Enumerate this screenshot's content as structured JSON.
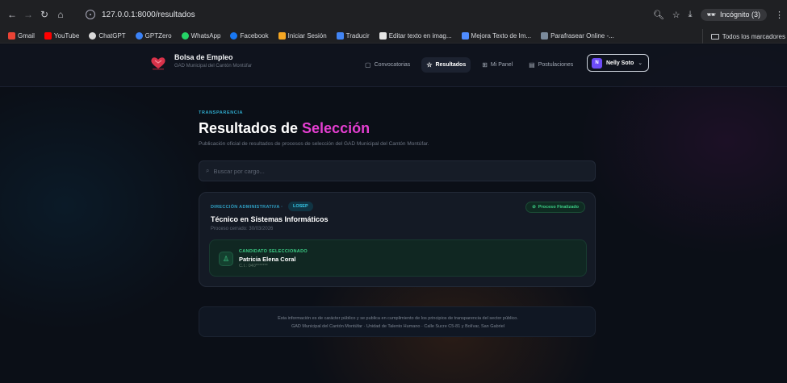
{
  "browser": {
    "url": "127.0.0.1:8000/resultados",
    "incognito_label": "Incógnito (3)",
    "bookmarks": [
      {
        "label": "Gmail",
        "color": "#ea4335"
      },
      {
        "label": "YouTube",
        "color": "#ff0000"
      },
      {
        "label": "ChatGPT",
        "color": "#d9d9d9"
      },
      {
        "label": "GPTZero",
        "color": "#3b82f6"
      },
      {
        "label": "WhatsApp",
        "color": "#25d366"
      },
      {
        "label": "Facebook",
        "color": "#1877f2"
      },
      {
        "label": "Iniciar Sesión",
        "color": "#f5a623"
      },
      {
        "label": "Traducir",
        "color": "#4285f4"
      },
      {
        "label": "Editar texto en imag...",
        "color": "#e6e6e6"
      },
      {
        "label": "Mejora Texto de Im...",
        "color": "#4f8cff"
      },
      {
        "label": "Parafrasear Online -...",
        "color": "#7b8a9b"
      }
    ],
    "bookmarks_folder": "Todos los marcadores"
  },
  "header": {
    "brand_title": "Bolsa de Empleo",
    "brand_subtitle": "GAD Municipal del Cantón Montúfar",
    "nav": [
      {
        "label": "Convocatorias",
        "icon": "document-icon"
      },
      {
        "label": "Resultados",
        "icon": "star-icon",
        "active": true
      },
      {
        "label": "Mi Panel",
        "icon": "grid-icon"
      },
      {
        "label": "Postulaciones",
        "icon": "file-icon"
      }
    ],
    "user": {
      "initial": "N",
      "name": "Nelly Soto"
    }
  },
  "hero": {
    "eyebrow": "TRANSPARENCIA",
    "title_main": "Resultados de ",
    "title_accent": "Selección",
    "description": "Publicación oficial de resultados de procesos de selección del GAD Municipal del Cantón Montúfar."
  },
  "search": {
    "placeholder": "Buscar por cargo..."
  },
  "result": {
    "department": "DIRECCIÓN ADMINISTRATIVA",
    "separator": "·",
    "tag": "LOSEP",
    "status": "Proceso Finalizado",
    "title": "Técnico en Sistemas Informáticos",
    "closed": "Proceso cerrado: 30/03/2026",
    "candidate_label": "CANDIDATO SELECCIONADO",
    "candidate_name": "Patricia Elena Coral",
    "candidate_ci": "C.I.: 040*******"
  },
  "footer": {
    "line1": "Esta información es de carácter público y se publica en cumplimiento de los principios de transparencia del sector público.",
    "line2": "GAD Municipal del Cantón Montúfar · Unidad de Talento Humano · Calle Sucre C5-81 y Bolívar, San Gabriel"
  },
  "colors": {
    "accent": "#e63fd2",
    "teal": "#2fa8c9",
    "success": "#3ccf86"
  }
}
